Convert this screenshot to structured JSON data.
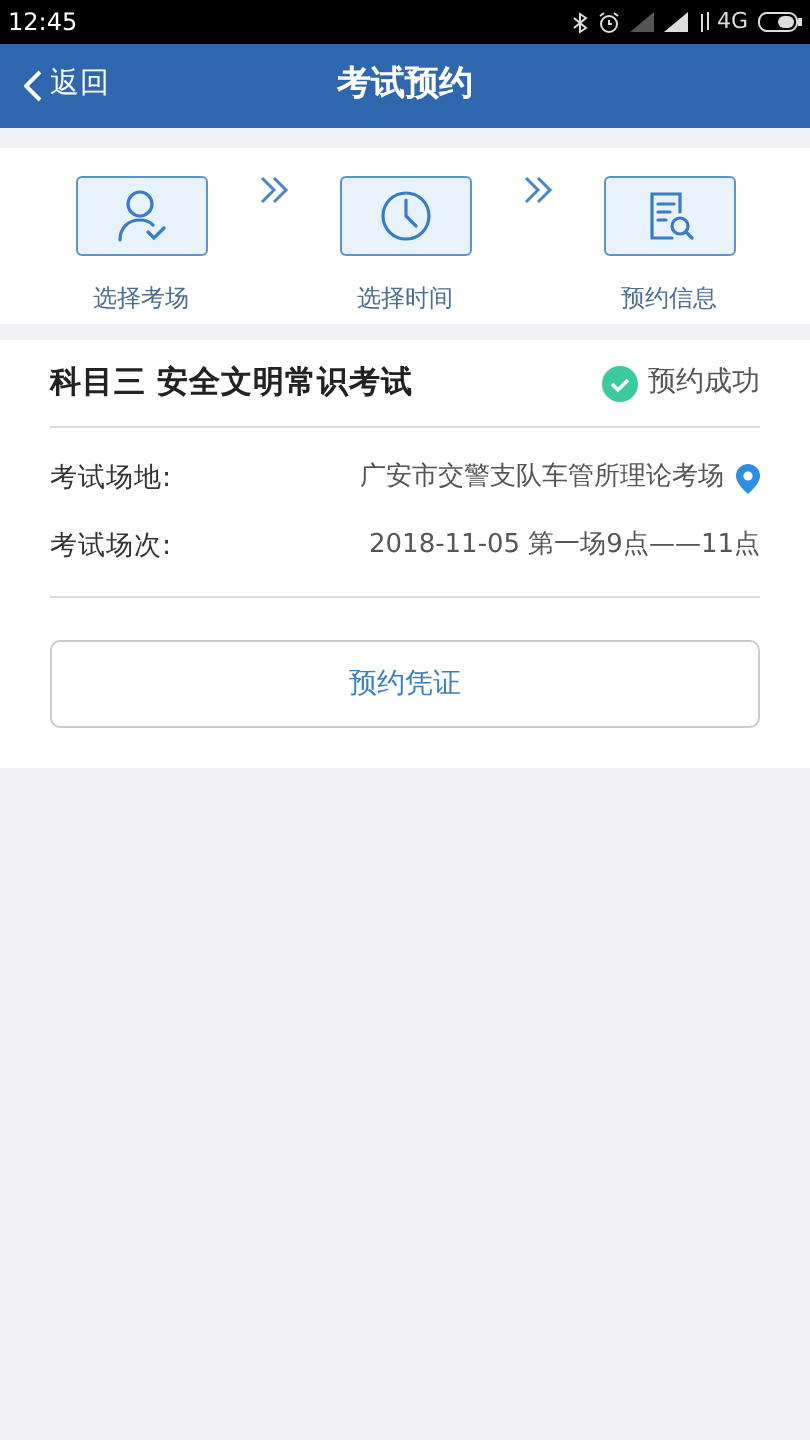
{
  "status_bar": {
    "time": "12:45",
    "network": "4G"
  },
  "header": {
    "back": "返回",
    "title": "考试预约"
  },
  "steps": [
    {
      "kind": "person",
      "label": "选择考场"
    },
    {
      "kind": "clock",
      "label": "选择时间"
    },
    {
      "kind": "document",
      "label": "预约信息"
    }
  ],
  "booking": {
    "title": "科目三 安全文明常识考试",
    "status": "预约成功",
    "fields": [
      {
        "label": "考试场地:",
        "value": "广安市交警支队车管所理论考场",
        "kind": "location"
      },
      {
        "label": "考试场次:",
        "value": "2018-11-05 第一场9点——11点",
        "kind": "text"
      }
    ],
    "button": "预约凭证"
  }
}
